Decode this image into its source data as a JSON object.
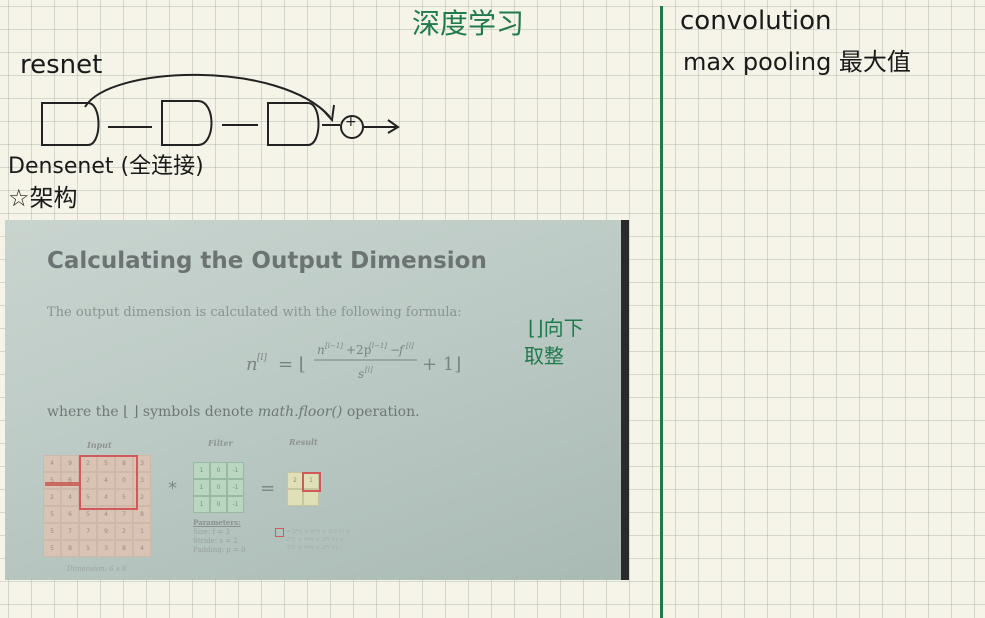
{
  "notes": {
    "left_title": "深度学习",
    "resnet": "resnet",
    "densenet": "Densenet (全连接)",
    "architecture": "☆架构",
    "plus_symbol": "+",
    "right_line1": "convolution",
    "right_line2": "max pooling 最大值",
    "green_annot_1": "⌊⌋向下",
    "green_annot_2": "取整"
  },
  "slide": {
    "title": "Calculating the Output Dimension",
    "subtitle": "The output dimension is calculated with the following formula:",
    "where_prefix": "where the ⌊ ⌋ symbols denote ",
    "where_code": "math.floor()",
    "where_suffix": " operation.",
    "input_label": "Input",
    "filter_label": "Filter",
    "result_label": "Result",
    "input_values": [
      "4",
      "9",
      "2",
      "5",
      "8",
      "3",
      "5",
      "6",
      "2",
      "4",
      "0",
      "3",
      "2",
      "4",
      "5",
      "4",
      "5",
      "2",
      "5",
      "6",
      "5",
      "4",
      "7",
      "8",
      "5",
      "7",
      "7",
      "9",
      "2",
      "1",
      "5",
      "8",
      "5",
      "3",
      "8",
      "4"
    ],
    "filter_values": [
      "1",
      "0",
      "-1",
      "1",
      "0",
      "-1",
      "1",
      "0",
      "-1"
    ],
    "result_values": [
      "2",
      "1",
      "",
      ""
    ],
    "times_op": "*",
    "equals_op": "=",
    "params_title": "Parameters:",
    "params_size": "Size:      f = 3",
    "params_stride": "Stride:    s = 2",
    "params_padding": "Padding:  p = 0",
    "calc_1": "= 2*1 + 9*0 + 2*(-1) +",
    "calc_2": "  2*1 + 4*0 + 3*(-1) +",
    "calc_3": "  5*1 + 4*0 + 2*(-1)",
    "dimension": "Dimension: 6 x 6"
  }
}
